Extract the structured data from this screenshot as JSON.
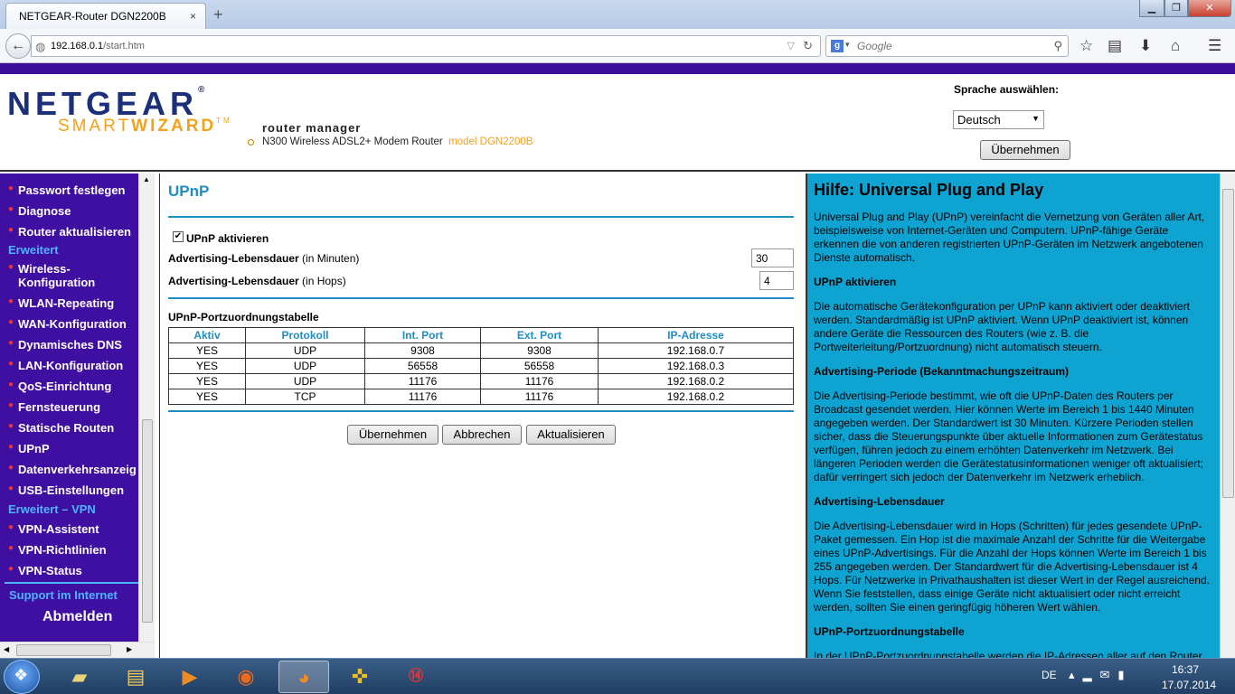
{
  "window": {
    "title": "NETGEAR-Router DGN2200B",
    "tab_close": "×",
    "new_tab": "+",
    "min": "▁",
    "max": "❐",
    "close": "✕"
  },
  "browser": {
    "url_host": "192.168.0.1",
    "url_path": "/start.htm",
    "search_placeholder": "Google",
    "search_engine_letter": "g"
  },
  "header": {
    "brand": "NETGEAR",
    "brand_mark": "®",
    "product_light": "SMART",
    "product_bold": "WIZARD",
    "product_mark": "TM",
    "subtitle": "router manager",
    "device": "N300 Wireless ADSL2+ Modem Router",
    "model": "model DGN2200B",
    "lang_label": "Sprache auswählen:",
    "lang_value": "Deutsch",
    "lang_apply": "Übernehmen"
  },
  "sidebar": {
    "items_top": [
      "Passwort festlegen",
      "Diagnose",
      "Router aktualisieren"
    ],
    "section_advanced": "Erweitert",
    "items_advanced": [
      "Wireless-\nKonfiguration",
      "WLAN-Repeating",
      "WAN-Konfiguration",
      "Dynamisches DNS",
      "LAN-Konfiguration",
      "QoS-Einrichtung",
      "Fernsteuerung",
      "Statische Routen",
      "UPnP",
      "Datenverkehrsanzeig",
      "USB-Einstellungen"
    ],
    "section_vpn": "Erweitert – VPN",
    "items_vpn": [
      "VPN-Assistent",
      "VPN-Richtlinien",
      "VPN-Status"
    ],
    "support": "Support im Internet",
    "logout": "Abmelden"
  },
  "main": {
    "title": "UPnP",
    "enable_label": "UPnP aktivieren",
    "enable_checked": true,
    "lifetime_minutes_label_bold": "Advertising-Lebensdauer",
    "lifetime_minutes_label_rest": " (in Minuten)",
    "lifetime_minutes_value": "30",
    "lifetime_hops_label_bold": "Advertising-Lebensdauer",
    "lifetime_hops_label_rest": " (in Hops)",
    "lifetime_hops_value": "4",
    "table_title": "UPnP-Portzuordnungstabelle",
    "table_headers": [
      "Aktiv",
      "Protokoll",
      "Int. Port",
      "Ext. Port",
      "IP-Adresse"
    ],
    "table_rows": [
      [
        "YES",
        "UDP",
        "9308",
        "9308",
        "192.168.0.7"
      ],
      [
        "YES",
        "UDP",
        "56558",
        "56558",
        "192.168.0.3"
      ],
      [
        "YES",
        "UDP",
        "11176",
        "11176",
        "192.168.0.2"
      ],
      [
        "YES",
        "TCP",
        "11176",
        "11176",
        "192.168.0.2"
      ]
    ],
    "btn_apply": "Übernehmen",
    "btn_cancel": "Abbrechen",
    "btn_refresh": "Aktualisieren"
  },
  "help": {
    "title": "Hilfe: Universal Plug and Play",
    "p1": "Universal Plug and Play (UPnP) vereinfacht die Vernetzung von Geräten aller Art, beispielsweise von Internet-Geräten und Computern. UPnP-fähige Geräte erkennen die von anderen registrierten UPnP-Geräten im Netzwerk angebotenen Dienste automatisch.",
    "h2": "UPnP aktivieren",
    "p2": "Die automatische Gerätekonfiguration per UPnP kann aktiviert oder deaktiviert werden. Standardmäßig ist UPnP aktiviert. Wenn UPnP deaktiviert ist, können andere Geräte die Ressourcen des Routers (wie z. B. die Portweiterleitung/Portzuordnung) nicht automatisch steuern.",
    "h3": "Advertising-Periode (Bekanntmachungszeitraum)",
    "p3": "Die Advertising-Periode bestimmt, wie oft die UPnP-Daten des Routers per Broadcast gesendet werden. Hier können Werte im Bereich 1 bis 1440 Minuten angegeben werden. Der Standardwert ist 30 Minuten. Kürzere Perioden stellen sicher, dass die Steuerungspunkte über aktuelle Informationen zum Gerätestatus verfügen, führen jedoch zu einem erhöhten Datenverkehr im Netzwerk. Bei längeren Perioden werden die Gerätestatusinformationen weniger oft aktualisiert; dafür verringert sich jedoch der Datenverkehr im Netzwerk erheblich.",
    "h4": "Advertising-Lebensdauer",
    "p4": "Die Advertising-Lebensdauer wird in Hops (Schritten) für jedes gesendete UPnP-Paket gemessen. Ein Hop ist die maximale Anzahl der Schritte für die Weitergabe eines UPnP-Advertisings. Für die Anzahl der Hops können Werte im Bereich 1 bis 255 angegeben werden. Der Standardwert für die Advertising-Lebensdauer ist 4 Hops. Für Netzwerke in Privathaushalten ist dieser Wert in der Regel ausreichend. Wenn Sie feststellen, dass einige Geräte nicht aktualisiert oder nicht erreicht werden, sollten Sie einen geringfügig höheren Wert wählen.",
    "h5": "UPnP-Portzuordnungstabelle",
    "p5": "In der UPnP-Portzuordnungstabelle werden die IP-Adressen aller auf den Router"
  },
  "taskbar": {
    "lang": "DE",
    "time": "16:37",
    "date": "17.07.2014"
  },
  "colors": {
    "purple": "#3f0fa2",
    "link_blue": "#1e8dc4",
    "help_bg": "#0fa3d1",
    "bullet_red": "#ee3333"
  }
}
